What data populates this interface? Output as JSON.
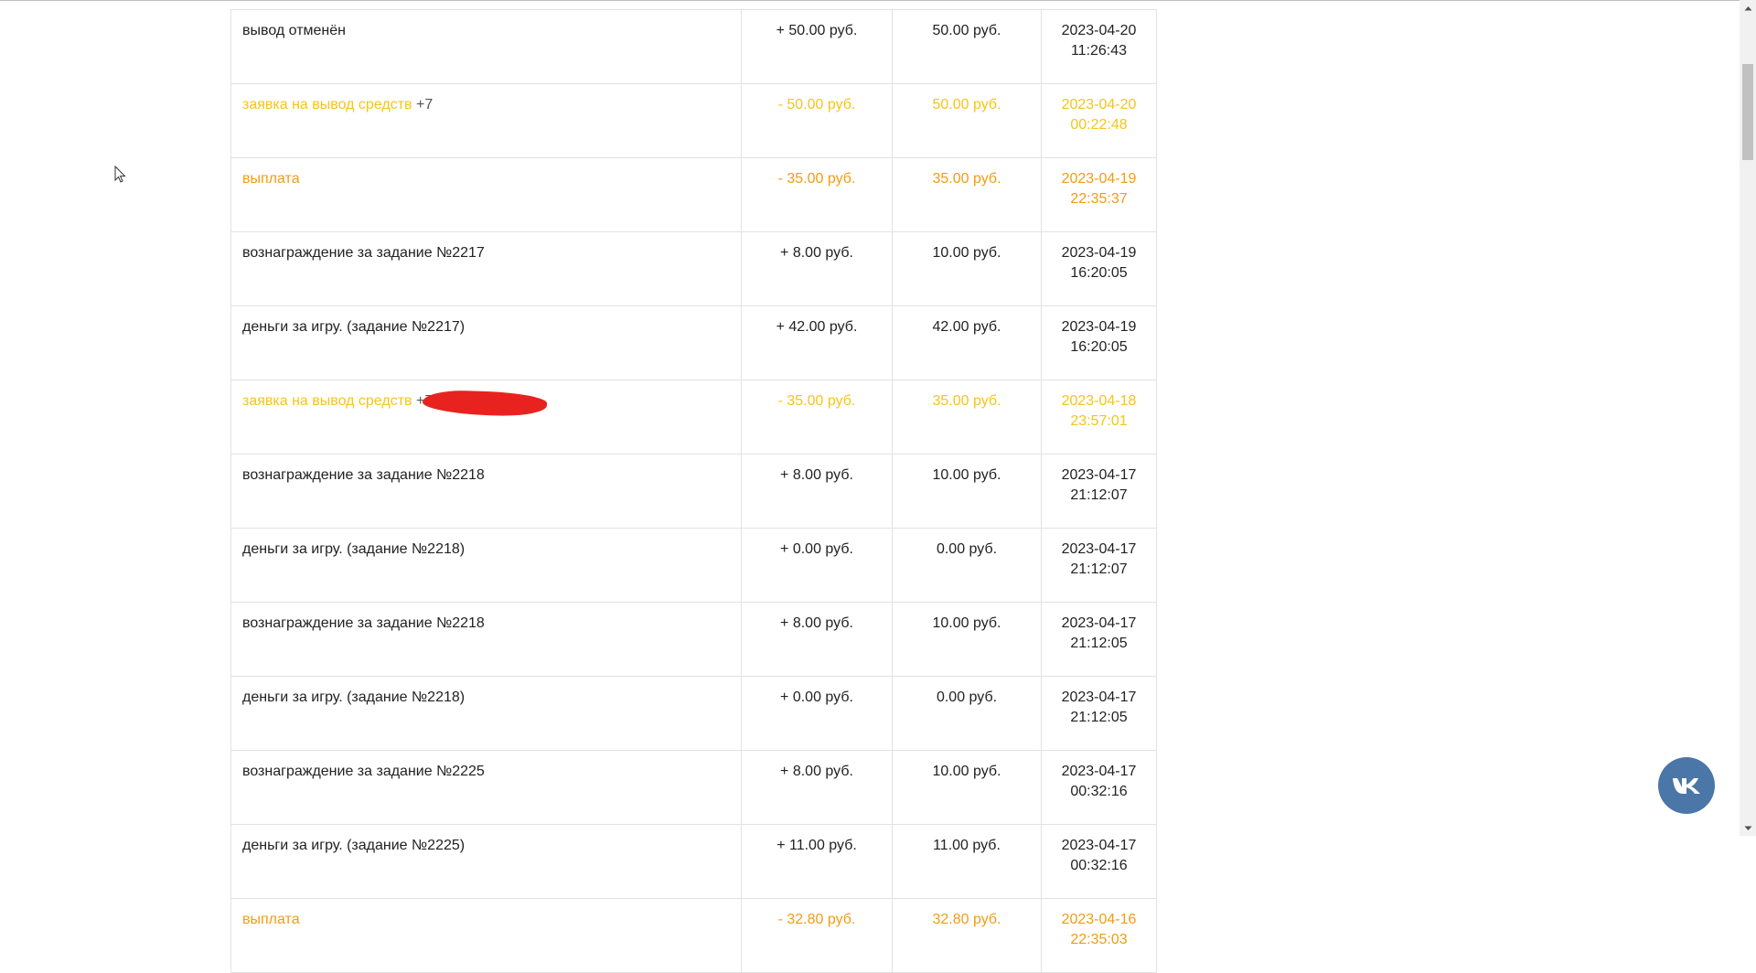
{
  "rows": [
    {
      "desc": "вывод отменён",
      "phone": "",
      "amount": "+ 50.00 руб.",
      "balance": "50.00 руб.",
      "date": "2023-04-20",
      "time": "11:26:43",
      "style": "normal"
    },
    {
      "desc": "заявка на вывод средств",
      "phone": "+7",
      "amount": "- 50.00 руб.",
      "balance": "50.00 руб.",
      "date": "2023-04-20",
      "time": "00:22:48",
      "style": "yellow"
    },
    {
      "desc": "выплата",
      "phone": "",
      "amount": "- 35.00 руб.",
      "balance": "35.00 руб.",
      "date": "2023-04-19",
      "time": "22:35:37",
      "style": "orange"
    },
    {
      "desc": "вознаграждение за задание №2217",
      "phone": "",
      "amount": "+ 8.00 руб.",
      "balance": "10.00 руб.",
      "date": "2023-04-19",
      "time": "16:20:05",
      "style": "normal"
    },
    {
      "desc": "деньги за игру. (задание №2217)",
      "phone": "",
      "amount": "+ 42.00 руб.",
      "balance": "42.00 руб.",
      "date": "2023-04-19",
      "time": "16:20:05",
      "style": "normal"
    },
    {
      "desc": "заявка на вывод средств",
      "phone": "+7",
      "amount": "- 35.00 руб.",
      "balance": "35.00 руб.",
      "date": "2023-04-18",
      "time": "23:57:01",
      "style": "yellow",
      "redacted": true
    },
    {
      "desc": "вознаграждение за задание №2218",
      "phone": "",
      "amount": "+ 8.00 руб.",
      "balance": "10.00 руб.",
      "date": "2023-04-17",
      "time": "21:12:07",
      "style": "normal"
    },
    {
      "desc": "деньги за игру. (задание №2218)",
      "phone": "",
      "amount": "+ 0.00 руб.",
      "balance": "0.00 руб.",
      "date": "2023-04-17",
      "time": "21:12:07",
      "style": "normal"
    },
    {
      "desc": "вознаграждение за задание №2218",
      "phone": "",
      "amount": "+ 8.00 руб.",
      "balance": "10.00 руб.",
      "date": "2023-04-17",
      "time": "21:12:05",
      "style": "normal"
    },
    {
      "desc": "деньги за игру. (задание №2218)",
      "phone": "",
      "amount": "+ 0.00 руб.",
      "balance": "0.00 руб.",
      "date": "2023-04-17",
      "time": "21:12:05",
      "style": "normal"
    },
    {
      "desc": "вознаграждение за задание №2225",
      "phone": "",
      "amount": "+ 8.00 руб.",
      "balance": "10.00 руб.",
      "date": "2023-04-17",
      "time": "00:32:16",
      "style": "normal"
    },
    {
      "desc": "деньги за игру. (задание №2225)",
      "phone": "",
      "amount": "+ 11.00 руб.",
      "balance": "11.00 руб.",
      "date": "2023-04-17",
      "time": "00:32:16",
      "style": "normal"
    },
    {
      "desc": "выплата",
      "phone": "",
      "amount": "- 32.80 руб.",
      "balance": "32.80 руб.",
      "date": "2023-04-16",
      "time": "22:35:03",
      "style": "orange"
    }
  ],
  "colors": {
    "normal_text": "#222222",
    "withdrawal_request": "#f5c518",
    "payout": "#f39c12",
    "phone_text": "#555555",
    "redaction": "#e8231f",
    "vk_button": "#4a76a8"
  },
  "icons": {
    "cursor": "mouse-pointer-icon",
    "vk": "vk-logo-icon",
    "scroll_up": "chevron-up-icon",
    "scroll_down": "chevron-down-icon"
  }
}
